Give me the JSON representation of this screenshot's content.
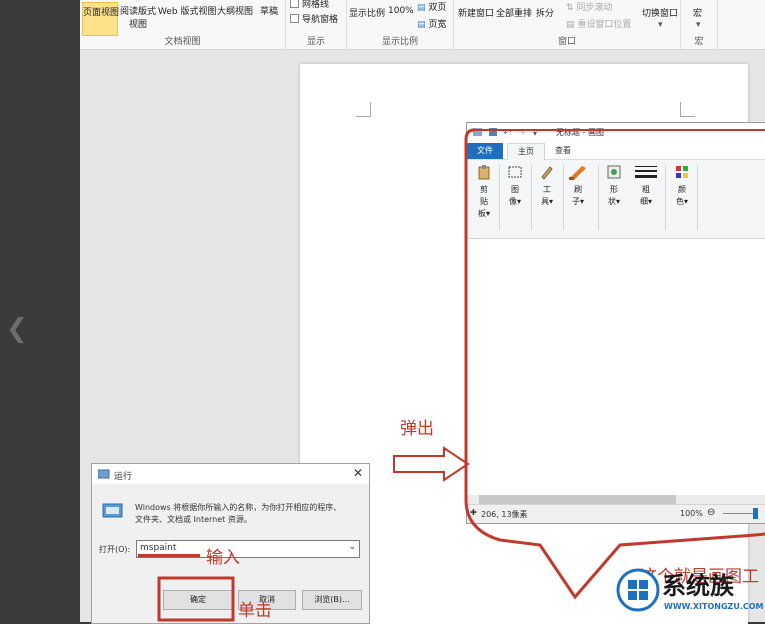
{
  "ribbon": {
    "view_group": {
      "label": "文档视图",
      "buttons": [
        "页面视图",
        "阅读版式",
        "Web 版式视图",
        "大纲视图",
        "草稿"
      ],
      "read_sub": "视图"
    },
    "show_group": {
      "label": "显示",
      "gridlines": "网格线",
      "nav_pane": "导航窗格"
    },
    "zoom_group": {
      "label": "显示比例",
      "zoom": "显示比例",
      "percent": "100%",
      "two_page": "双页",
      "page_width": "页宽"
    },
    "window_group": {
      "label": "窗口",
      "new_window": "新建窗口",
      "arrange_all": "全部重排",
      "split": "拆分",
      "sync_scroll": "同步滚动",
      "reset_pos": "重设窗口位置",
      "switch": "切换窗口"
    },
    "macro_group": {
      "label": "宏",
      "macro": "宏"
    }
  },
  "paint": {
    "title": "无标题 - 画图",
    "tabs": [
      "文件",
      "主页",
      "查看"
    ],
    "tools": [
      {
        "label": "剪贴板",
        "l1": "剪",
        "l2": "贴",
        "l3": "板"
      },
      {
        "label": "图像",
        "l1": "图",
        "l2": "像"
      },
      {
        "label": "工具",
        "l1": "工",
        "l2": "具"
      },
      {
        "label": "刷子",
        "l1": "刷",
        "l2": "子"
      },
      {
        "label": "形状",
        "l1": "形",
        "l2": "状"
      },
      {
        "label": "粗细",
        "l1": "粗",
        "l2": "细"
      },
      {
        "label": "颜色",
        "l1": "颜",
        "l2": "色"
      }
    ],
    "status_pos": "206, 13像素",
    "zoom": "100%"
  },
  "run": {
    "title": "运行",
    "description_line1": "Windows 将根据你所输入的名称，为你打开相应的程序、",
    "description_line2": "文件夹、文档或 Internet 资源。",
    "open_label": "打开(O):",
    "open_value": "mspaint",
    "ok": "确定",
    "cancel": "取消",
    "browse": "浏览(B)..."
  },
  "annotations": {
    "popup": "弹出",
    "input": "输入",
    "click": "单击",
    "this_is": "这个就是画图工"
  },
  "watermark": {
    "brand": "系统族",
    "url": "WWW.XITONGZU.COM"
  },
  "colors": {
    "annotation": "#c0392b",
    "active_tab": "#fde28a",
    "paint_file_tab": "#1e6fbf"
  }
}
